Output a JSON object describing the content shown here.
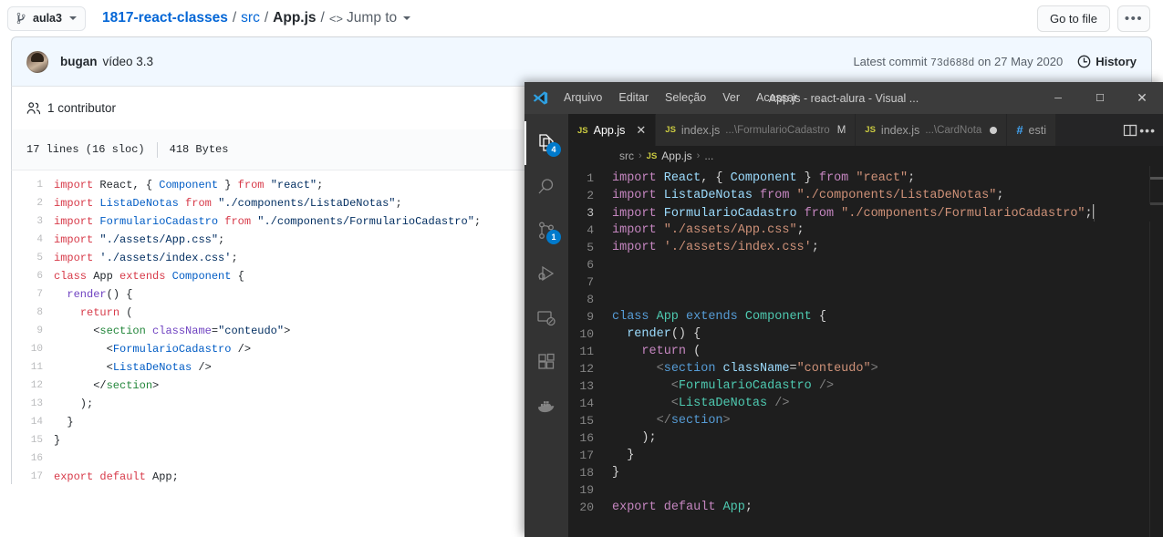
{
  "github": {
    "branch_button": {
      "label": "aula3",
      "icon": "branch-icon"
    },
    "breadcrumb": {
      "repo": "1817-react-classes",
      "dir": "src",
      "file": "App.js",
      "jump_to": "Jump to",
      "separator": "/"
    },
    "actions": {
      "go_to_file": "Go to file",
      "kebab": "•••"
    },
    "commit": {
      "author": "bugan",
      "message": "vídeo 3.3",
      "latest_prefix": "Latest commit",
      "sha": "73d688d",
      "date_prefix": "on",
      "date": "27 May 2020",
      "history_label": "History"
    },
    "contributors": {
      "label": "1 contributor"
    },
    "file_meta": {
      "lines": "17 lines (16 sloc)",
      "size": "418 Bytes"
    },
    "code_lines": [
      {
        "n": "1",
        "tokens": [
          {
            "t": "import ",
            "c": "g-kw"
          },
          {
            "t": "React",
            "c": "g-plain"
          },
          {
            "t": ", { ",
            "c": "g-plain"
          },
          {
            "t": "Component",
            "c": "g-const"
          },
          {
            "t": " } ",
            "c": "g-plain"
          },
          {
            "t": "from ",
            "c": "g-kw"
          },
          {
            "t": "\"react\"",
            "c": "g-str"
          },
          {
            "t": ";",
            "c": "g-plain"
          }
        ]
      },
      {
        "n": "2",
        "tokens": [
          {
            "t": "import ",
            "c": "g-kw"
          },
          {
            "t": "ListaDeNotas",
            "c": "g-const"
          },
          {
            "t": " ",
            "c": "g-plain"
          },
          {
            "t": "from ",
            "c": "g-kw"
          },
          {
            "t": "\"./components/ListaDeNotas\"",
            "c": "g-str"
          },
          {
            "t": ";",
            "c": "g-plain"
          }
        ]
      },
      {
        "n": "3",
        "tokens": [
          {
            "t": "import ",
            "c": "g-kw"
          },
          {
            "t": "FormularioCadastro",
            "c": "g-const"
          },
          {
            "t": " ",
            "c": "g-plain"
          },
          {
            "t": "from ",
            "c": "g-kw"
          },
          {
            "t": "\"./components/FormularioCadastro\"",
            "c": "g-str"
          },
          {
            "t": ";",
            "c": "g-plain"
          }
        ]
      },
      {
        "n": "4",
        "tokens": [
          {
            "t": "import ",
            "c": "g-kw"
          },
          {
            "t": "\"./assets/App.css\"",
            "c": "g-str"
          },
          {
            "t": ";",
            "c": "g-plain"
          }
        ]
      },
      {
        "n": "5",
        "tokens": [
          {
            "t": "import ",
            "c": "g-kw"
          },
          {
            "t": "'./assets/index.css'",
            "c": "g-str"
          },
          {
            "t": ";",
            "c": "g-plain"
          }
        ]
      },
      {
        "n": "6",
        "tokens": [
          {
            "t": "class ",
            "c": "g-kw"
          },
          {
            "t": "App",
            "c": "g-plain"
          },
          {
            "t": " ",
            "c": "g-plain"
          },
          {
            "t": "extends ",
            "c": "g-kw"
          },
          {
            "t": "Component",
            "c": "g-const"
          },
          {
            "t": " {",
            "c": "g-plain"
          }
        ]
      },
      {
        "n": "7",
        "tokens": [
          {
            "t": "  ",
            "c": "g-plain"
          },
          {
            "t": "render",
            "c": "g-ent"
          },
          {
            "t": "() {",
            "c": "g-plain"
          }
        ]
      },
      {
        "n": "8",
        "tokens": [
          {
            "t": "    ",
            "c": "g-plain"
          },
          {
            "t": "return",
            "c": "g-kw"
          },
          {
            "t": " (",
            "c": "g-plain"
          }
        ]
      },
      {
        "n": "9",
        "tokens": [
          {
            "t": "      <",
            "c": "g-plain"
          },
          {
            "t": "section",
            "c": "g-tag"
          },
          {
            "t": " ",
            "c": "g-plain"
          },
          {
            "t": "className",
            "c": "g-attr"
          },
          {
            "t": "=",
            "c": "g-plain"
          },
          {
            "t": "\"conteudo\"",
            "c": "g-str"
          },
          {
            "t": ">",
            "c": "g-plain"
          }
        ]
      },
      {
        "n": "10",
        "tokens": [
          {
            "t": "        <",
            "c": "g-plain"
          },
          {
            "t": "FormularioCadastro",
            "c": "g-const"
          },
          {
            "t": " />",
            "c": "g-plain"
          }
        ]
      },
      {
        "n": "11",
        "tokens": [
          {
            "t": "        <",
            "c": "g-plain"
          },
          {
            "t": "ListaDeNotas",
            "c": "g-const"
          },
          {
            "t": " />",
            "c": "g-plain"
          }
        ]
      },
      {
        "n": "12",
        "tokens": [
          {
            "t": "      </",
            "c": "g-plain"
          },
          {
            "t": "section",
            "c": "g-tag"
          },
          {
            "t": ">",
            "c": "g-plain"
          }
        ]
      },
      {
        "n": "13",
        "tokens": [
          {
            "t": "    );",
            "c": "g-plain"
          }
        ]
      },
      {
        "n": "14",
        "tokens": [
          {
            "t": "  }",
            "c": "g-plain"
          }
        ]
      },
      {
        "n": "15",
        "tokens": [
          {
            "t": "}",
            "c": "g-plain"
          }
        ]
      },
      {
        "n": "16",
        "tokens": [
          {
            "t": "",
            "c": "g-plain"
          }
        ]
      },
      {
        "n": "17",
        "tokens": [
          {
            "t": "export ",
            "c": "g-kw"
          },
          {
            "t": "default ",
            "c": "g-kw"
          },
          {
            "t": "App",
            "c": "g-plain"
          },
          {
            "t": ";",
            "c": "g-plain"
          }
        ]
      }
    ]
  },
  "vscode": {
    "titlebar": {
      "menus": [
        "Arquivo",
        "Editar",
        "Seleção",
        "Ver",
        "Acessar",
        "…"
      ],
      "window_title": "App.js - react-alura - Visual ...",
      "minimize": "─",
      "maximize": "☐",
      "close": "✕"
    },
    "activity_bar": [
      {
        "name": "explorer-icon",
        "badge": "4",
        "active": true
      },
      {
        "name": "search-icon",
        "badge": null,
        "active": false
      },
      {
        "name": "source-control-icon",
        "badge": "1",
        "active": false
      },
      {
        "name": "run-and-debug-icon",
        "badge": null,
        "active": false
      },
      {
        "name": "remote-explorer-icon",
        "badge": null,
        "active": false
      },
      {
        "name": "extensions-icon",
        "badge": null,
        "active": false
      },
      {
        "name": "docker-icon",
        "badge": null,
        "active": false
      }
    ],
    "tabs": [
      {
        "icon": "js-file-icon",
        "label": "App.js",
        "path": "",
        "status": "",
        "dirty": false,
        "active": true,
        "closable": true
      },
      {
        "icon": "js-file-icon",
        "label": "index.js",
        "path": "...\\FormularioCadastro",
        "status": "M",
        "dirty": false,
        "active": false,
        "closable": false
      },
      {
        "icon": "js-file-icon",
        "label": "index.js",
        "path": "...\\CardNota",
        "status": "",
        "dirty": true,
        "active": false,
        "closable": false
      },
      {
        "icon": "css-file-icon",
        "label": "esti",
        "path": "",
        "status": "",
        "dirty": false,
        "active": false,
        "closable": false
      }
    ],
    "tab_actions": {
      "split_editor": "split-editor-icon",
      "more": "•••"
    },
    "breadcrumb": {
      "folder": "src",
      "file": "App.js",
      "symbol": "...",
      "separator": "›"
    },
    "code_lines": [
      {
        "n": "1",
        "current": false,
        "tokens": [
          {
            "t": "import ",
            "c": "v-kw"
          },
          {
            "t": "React",
            "c": "v-id"
          },
          {
            "t": ", { ",
            "c": "v-punc"
          },
          {
            "t": "Component",
            "c": "v-id"
          },
          {
            "t": " } ",
            "c": "v-punc"
          },
          {
            "t": "from ",
            "c": "v-kw"
          },
          {
            "t": "\"react\"",
            "c": "v-str"
          },
          {
            "t": ";",
            "c": "v-punc"
          }
        ]
      },
      {
        "n": "2",
        "current": false,
        "tokens": [
          {
            "t": "import ",
            "c": "v-kw"
          },
          {
            "t": "ListaDeNotas",
            "c": "v-id"
          },
          {
            "t": " ",
            "c": "v-punc"
          },
          {
            "t": "from ",
            "c": "v-kw"
          },
          {
            "t": "\"./components/ListaDeNotas\"",
            "c": "v-str"
          },
          {
            "t": ";",
            "c": "v-punc"
          }
        ]
      },
      {
        "n": "3",
        "current": true,
        "tokens": [
          {
            "t": "import ",
            "c": "v-kw"
          },
          {
            "t": "FormularioCadastro",
            "c": "v-id"
          },
          {
            "t": " ",
            "c": "v-punc"
          },
          {
            "t": "from ",
            "c": "v-kw"
          },
          {
            "t": "\"./components/FormularioCadastro\"",
            "c": "v-str"
          },
          {
            "t": ";",
            "c": "v-punc"
          }
        ]
      },
      {
        "n": "4",
        "current": false,
        "tokens": [
          {
            "t": "import ",
            "c": "v-kw"
          },
          {
            "t": "\"./assets/App.css\"",
            "c": "v-str"
          },
          {
            "t": ";",
            "c": "v-punc"
          }
        ]
      },
      {
        "n": "5",
        "current": false,
        "tokens": [
          {
            "t": "import ",
            "c": "v-kw"
          },
          {
            "t": "'./assets/index.css'",
            "c": "v-str"
          },
          {
            "t": ";",
            "c": "v-punc"
          }
        ]
      },
      {
        "n": "6",
        "current": false,
        "tokens": [
          {
            "t": "",
            "c": "v-punc"
          }
        ]
      },
      {
        "n": "7",
        "current": false,
        "tokens": [
          {
            "t": "",
            "c": "v-punc"
          }
        ]
      },
      {
        "n": "8",
        "current": false,
        "tokens": [
          {
            "t": "",
            "c": "v-punc"
          }
        ]
      },
      {
        "n": "9",
        "current": false,
        "tokens": [
          {
            "t": "class ",
            "c": "v-blue"
          },
          {
            "t": "App",
            "c": "v-type"
          },
          {
            "t": " ",
            "c": "v-punc"
          },
          {
            "t": "extends ",
            "c": "v-blue"
          },
          {
            "t": "Component",
            "c": "v-type"
          },
          {
            "t": " {",
            "c": "v-punc"
          }
        ]
      },
      {
        "n": "10",
        "current": false,
        "tokens": [
          {
            "t": "  ",
            "c": "v-punc"
          },
          {
            "t": "render",
            "c": "v-id"
          },
          {
            "t": "() {",
            "c": "v-punc"
          }
        ]
      },
      {
        "n": "11",
        "current": false,
        "tokens": [
          {
            "t": "    ",
            "c": "v-punc"
          },
          {
            "t": "return",
            "c": "v-ctrl"
          },
          {
            "t": " (",
            "c": "v-punc"
          }
        ]
      },
      {
        "n": "12",
        "current": false,
        "tokens": [
          {
            "t": "      <",
            "c": "v-tag"
          },
          {
            "t": "section",
            "c": "v-blue"
          },
          {
            "t": " ",
            "c": "v-punc"
          },
          {
            "t": "className",
            "c": "v-id"
          },
          {
            "t": "=",
            "c": "v-punc"
          },
          {
            "t": "\"conteudo\"",
            "c": "v-str"
          },
          {
            "t": ">",
            "c": "v-tag"
          }
        ]
      },
      {
        "n": "13",
        "current": false,
        "tokens": [
          {
            "t": "        <",
            "c": "v-tag"
          },
          {
            "t": "FormularioCadastro",
            "c": "v-type"
          },
          {
            "t": " />",
            "c": "v-tag"
          }
        ]
      },
      {
        "n": "14",
        "current": false,
        "tokens": [
          {
            "t": "        <",
            "c": "v-tag"
          },
          {
            "t": "ListaDeNotas",
            "c": "v-type"
          },
          {
            "t": " />",
            "c": "v-tag"
          }
        ]
      },
      {
        "n": "15",
        "current": false,
        "tokens": [
          {
            "t": "      </",
            "c": "v-tag"
          },
          {
            "t": "section",
            "c": "v-blue"
          },
          {
            "t": ">",
            "c": "v-tag"
          }
        ]
      },
      {
        "n": "16",
        "current": false,
        "tokens": [
          {
            "t": "    );",
            "c": "v-punc"
          }
        ]
      },
      {
        "n": "17",
        "current": false,
        "tokens": [
          {
            "t": "  }",
            "c": "v-punc"
          }
        ]
      },
      {
        "n": "18",
        "current": false,
        "tokens": [
          {
            "t": "}",
            "c": "v-punc"
          }
        ]
      },
      {
        "n": "19",
        "current": false,
        "tokens": [
          {
            "t": "",
            "c": "v-punc"
          }
        ]
      },
      {
        "n": "20",
        "current": false,
        "tokens": [
          {
            "t": "export ",
            "c": "v-kw"
          },
          {
            "t": "default ",
            "c": "v-kw"
          },
          {
            "t": "App",
            "c": "v-type"
          },
          {
            "t": ";",
            "c": "v-punc"
          }
        ]
      }
    ]
  },
  "colors": {
    "gh_link": "#0366d6",
    "gh_commit_bg": "#f1f8ff",
    "vs_editor_bg": "#1e1e1e",
    "vs_activity_bg": "#333333",
    "vs_titlebar_bg": "#3c3c3c",
    "vs_badge": "#007acc",
    "vs_string": "#ce9178",
    "vs_keyword": "#c586c0",
    "vs_identifier": "#9cdcfe",
    "vs_type": "#4ec9b0"
  }
}
